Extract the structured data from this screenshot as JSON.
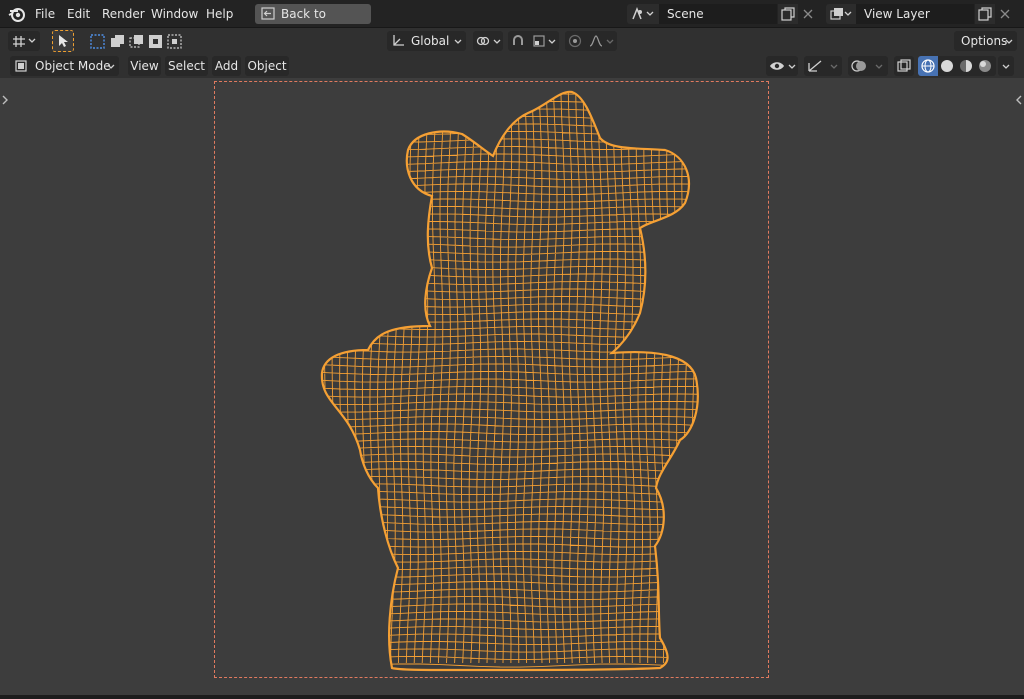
{
  "menu": {
    "file": "File",
    "edit": "Edit",
    "render": "Render",
    "window": "Window",
    "help": "Help",
    "back_to_previous": "Back to Previous"
  },
  "scene": {
    "name": "Scene"
  },
  "view_layer": {
    "name": "View Layer"
  },
  "toolbar": {
    "transform_orientation": "Global",
    "options": "Options"
  },
  "header": {
    "mode": "Object Mode",
    "view": "View",
    "select": "Select",
    "add": "Add",
    "object": "Object"
  },
  "colors": {
    "accent": "#4772b3",
    "wire": "#f5a034",
    "frame": "#e07a5f"
  }
}
